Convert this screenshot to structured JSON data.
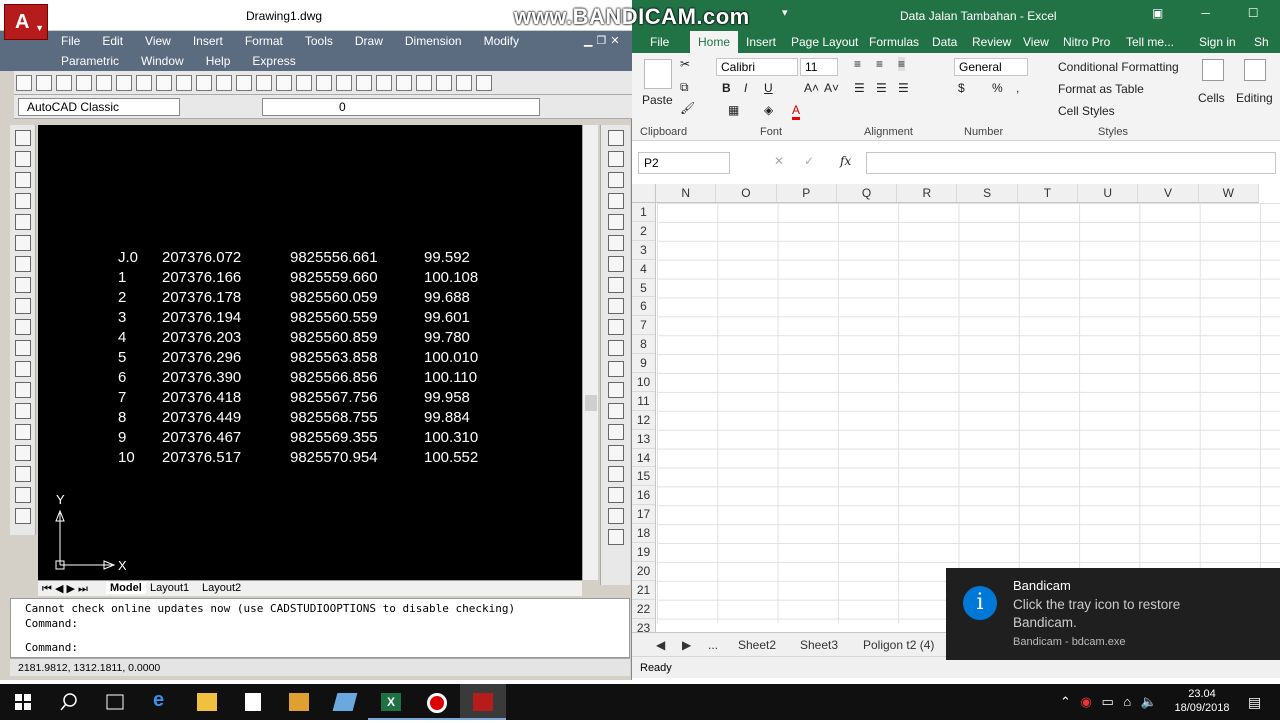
{
  "watermark": "www.BANDICAM.com",
  "autocad": {
    "title": "Drawing1.dwg",
    "menu_row1": [
      "File",
      "Edit",
      "View",
      "Insert",
      "Format",
      "Tools",
      "Draw",
      "Dimension",
      "Modify"
    ],
    "menu_row2": [
      "Parametric",
      "Window",
      "Help",
      "Express"
    ],
    "workspace": "AutoCAD Classic",
    "layer": "0",
    "survey_table": [
      [
        "J.0",
        "207376.072",
        "9825556.661",
        "99.592"
      ],
      [
        "1",
        "207376.166",
        "9825559.660",
        "100.108"
      ],
      [
        "2",
        "207376.178",
        "9825560.059",
        "99.688"
      ],
      [
        "3",
        "207376.194",
        "9825560.559",
        "99.601"
      ],
      [
        "4",
        "207376.203",
        "9825560.859",
        "99.780"
      ],
      [
        "5",
        "207376.296",
        "9825563.858",
        "100.010"
      ],
      [
        "6",
        "207376.390",
        "9825566.856",
        "100.110"
      ],
      [
        "7",
        "207376.418",
        "9825567.756",
        "99.958"
      ],
      [
        "8",
        "207376.449",
        "9825568.755",
        "99.884"
      ],
      [
        "9",
        "207376.467",
        "9825569.355",
        "100.310"
      ],
      [
        "10",
        "207376.517",
        "9825570.954",
        "100.552"
      ]
    ],
    "ucs": {
      "x_label": "X",
      "y_label": "Y"
    },
    "layout_tabs": [
      "Model",
      "Layout1",
      "Layout2"
    ],
    "command_history": [
      "Cannot check online updates now (use CADSTUDIOOPTIONS to disable checking)",
      "Command:"
    ],
    "command_prompt": "Command:",
    "coordinates": "2181.9812, 1312.1811, 0.0000"
  },
  "excel": {
    "title": "Data Jalan Tambahan - Excel",
    "tabs": [
      "File",
      "Home",
      "Insert",
      "Page Layout",
      "Formulas",
      "Data",
      "Review",
      "View",
      "Nitro Pro",
      "Tell me...",
      "Sign in",
      "Sh"
    ],
    "active_tab": "Home",
    "clipboard": {
      "paste": "Paste",
      "label": "Clipboard"
    },
    "font": {
      "name": "Calibri",
      "size": "11",
      "label": "Font"
    },
    "alignment_label": "Alignment",
    "number": {
      "format": "General",
      "label": "Number"
    },
    "styles": {
      "conditional": "Conditional Formatting",
      "table": "Format as Table",
      "cell": "Cell Styles",
      "label": "Styles"
    },
    "cells_label": "Cells",
    "editing_label": "Editing",
    "name_box": "P2",
    "fx": "fx",
    "columns": [
      "N",
      "O",
      "P",
      "Q",
      "R",
      "S",
      "T",
      "U",
      "V",
      "W"
    ],
    "rows": [
      "1",
      "2",
      "3",
      "4",
      "5",
      "6",
      "7",
      "8",
      "9",
      "10",
      "11",
      "12",
      "13",
      "14",
      "15",
      "16",
      "17",
      "18",
      "19",
      "20",
      "21",
      "22",
      "23"
    ],
    "sheets": [
      "...",
      "Sheet2",
      "Sheet3",
      "Poligon t2 (4)"
    ],
    "status": "Ready"
  },
  "toast": {
    "title": "Bandicam",
    "body": "Click the tray icon to restore Bandicam.",
    "source": "Bandicam - bdcam.exe"
  },
  "clock": {
    "time": "23.04",
    "date": "18/09/2018"
  }
}
